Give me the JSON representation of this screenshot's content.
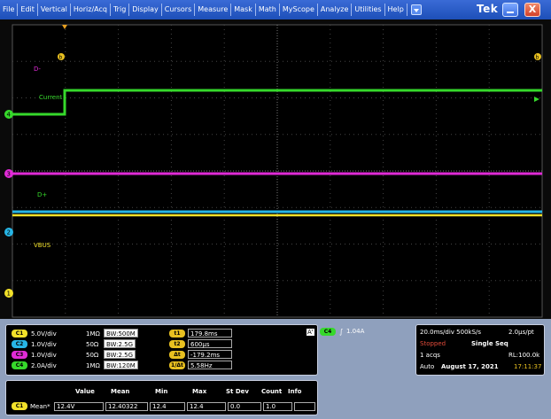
{
  "menu": {
    "items": [
      "File",
      "Edit",
      "Vertical",
      "Horiz/Acq",
      "Trig",
      "Display",
      "Cursors",
      "Measure",
      "Mask",
      "Math",
      "MyScope",
      "Analyze",
      "Utilities",
      "Help"
    ],
    "brand": "Tek",
    "close_glyph": "X"
  },
  "scope": {
    "labels": {
      "dminus": "D-",
      "current": "Current",
      "dplus": "D+",
      "vbus": "VBUS"
    },
    "ch_markers": [
      "1",
      "2",
      "3",
      "4"
    ],
    "cursor_marker": "b"
  },
  "channels": [
    {
      "id": "C1",
      "scale": "5.0V/div",
      "imp": "1MΩ",
      "bw": "500M",
      "color": "#f2e12a"
    },
    {
      "id": "C2",
      "scale": "1.0V/div",
      "imp": "50Ω",
      "bw": "2.5G",
      "color": "#27b6e6"
    },
    {
      "id": "C3",
      "scale": "1.0V/div",
      "imp": "50Ω",
      "bw": "2.5G",
      "color": "#e02bd6"
    },
    {
      "id": "C4",
      "scale": "2.0A/div",
      "imp": "1MΩ",
      "bw": "120M",
      "color": "#36d92b"
    }
  ],
  "bw_prefix": "BW:",
  "cursors": {
    "t1": {
      "tag": "t1",
      "value": "179.8ms"
    },
    "t2": {
      "tag": "t2",
      "value": "600μs"
    },
    "dt": {
      "tag": "Δt",
      "value": "-179.2ms"
    },
    "inv": {
      "tag": "1/Δt",
      "value": "5.58Hz"
    }
  },
  "trigger": {
    "a_label": "A'",
    "chan": "C4",
    "level": "1.04A"
  },
  "acq": {
    "horiz": "20.0ms/div 500kS/s",
    "res": "2.0μs/pt",
    "state": "Stopped",
    "mode": "Single Seq",
    "acqs": "1 acqs",
    "rl": "RL:100.0k",
    "auto": "Auto",
    "date": "August 17, 2021",
    "time": "17:11:37"
  },
  "measure": {
    "headers": [
      "Value",
      "Mean",
      "Min",
      "Max",
      "St Dev",
      "Count",
      "Info"
    ],
    "chan": "C1",
    "name": "Mean*",
    "row": [
      "12.4V",
      "12.40322",
      "12.4",
      "12.4",
      "0.0",
      "1.0",
      ""
    ]
  },
  "colors": {
    "c1": "#f2e12a",
    "c2": "#27b6e6",
    "c3": "#e02bd6",
    "c4": "#36d92b",
    "cursor": "#e8c020",
    "stopped": "#e24b3a"
  }
}
